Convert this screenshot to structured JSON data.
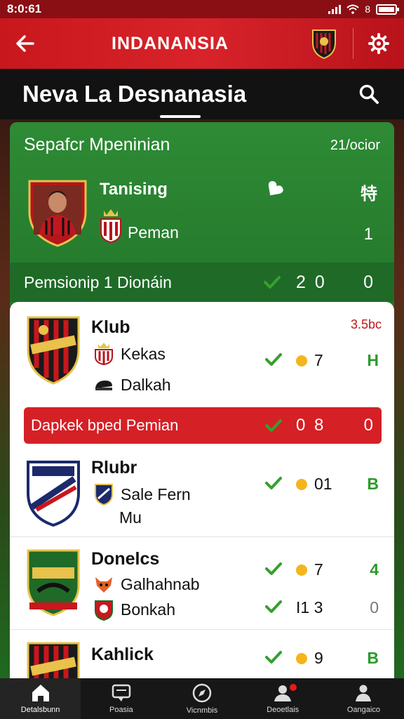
{
  "status": {
    "time": "8:0:61",
    "carrier_text": "8"
  },
  "topbar": {
    "title": "INDANANSIA"
  },
  "subheader": {
    "title": "Neva La Desnanasia"
  },
  "summary": {
    "title": "Sepafcr Mpeninian",
    "date": "21/ocior",
    "player_name": "Tanising",
    "position": "Peman",
    "stat_symbol": "特",
    "stat_value": "1",
    "footer_label": "Pemsionip 1 Dionáin",
    "footer_score": "2 0",
    "footer_right": "0"
  },
  "rows": [
    {
      "title": "Klub",
      "badge": "3.5bc",
      "line1": "Kekas",
      "line2": "Dalkah",
      "dot_value": "7",
      "right": "H"
    },
    {
      "title": "Rlubr",
      "line1": "Sale Fern",
      "line2": "Mu",
      "dot_value": "01",
      "right": "B"
    },
    {
      "title": "Donelcs",
      "line1": "Galhahnab",
      "line2": "Bonkah",
      "dot_value": "7",
      "right": "4",
      "line2_value": "I1 3",
      "line2_right": "0"
    },
    {
      "title": "Kahlick",
      "dot_value": "9",
      "right": "B"
    }
  ],
  "banner": {
    "label": "Dapkek bped Pemian",
    "score": "0 8",
    "right": "0"
  },
  "nav": [
    {
      "label": "Detalsbunn",
      "icon": "home-icon"
    },
    {
      "label": "Poasia",
      "icon": "chat-icon"
    },
    {
      "label": "Vicnmbis",
      "icon": "compass-icon"
    },
    {
      "label": "Deoetlais",
      "icon": "people-icon"
    },
    {
      "label": "Oangaico",
      "icon": "profile-icon"
    }
  ],
  "colors": {
    "primary_red": "#d52026",
    "green": "#2e8b35",
    "check": "#34a02f",
    "dot": "#f4b51c"
  }
}
